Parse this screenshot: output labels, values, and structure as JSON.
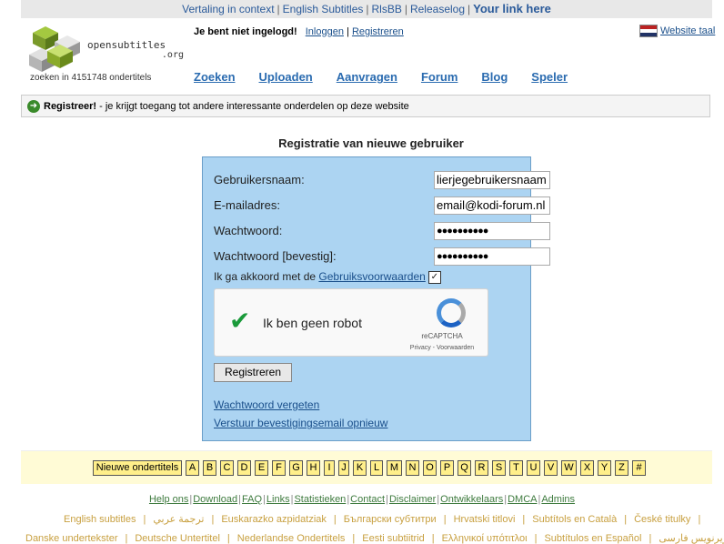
{
  "topbar": {
    "links": [
      "Vertaling in context",
      "English Subtitles",
      "RlsBB",
      "Releaselog"
    ],
    "highlight": "Your link here"
  },
  "header": {
    "logo_text": "opensubtitles",
    "logo_domain": ".org",
    "search_count": "zoeken in 4151748 ondertitels",
    "login_status": "Je bent niet ingelogd!",
    "login_link": "Inloggen",
    "register_link": "Registreren",
    "language": "Website taal"
  },
  "nav": [
    "Zoeken",
    "Uploaden",
    "Aanvragen",
    "Forum",
    "Blog",
    "Speler"
  ],
  "notice": {
    "bold": "Registreer!",
    "text": " - je krijgt toegang tot andere interessante onderdelen op deze website"
  },
  "form": {
    "title": "Registratie van nieuwe gebruiker",
    "username_label": "Gebruikersnaam:",
    "username_value": "lierjegebruikersnaam",
    "email_label": "E-mailadres:",
    "email_value": "email@kodi-forum.nl",
    "password_label": "Wachtwoord:",
    "password_value": "●●●●●●●●●●",
    "password_confirm_label": "Wachtwoord [bevestig]:",
    "password_confirm_value": "●●●●●●●●●●",
    "agree_text": "Ik ga akkoord met de ",
    "agree_link": "Gebruiksvoorwaarden",
    "agree_checked": "✓",
    "captcha_text": "Ik ben geen robot",
    "captcha_brand": "reCAPTCHA",
    "captcha_links": "Privacy - Voorwaarden",
    "submit_label": "Registreren",
    "forgot_password": "Wachtwoord vergeten",
    "resend_email": "Verstuur bevestigingsemail opnieuw"
  },
  "alphabet": {
    "new_label": "Nieuwe ondertitels",
    "letters": [
      "A",
      "B",
      "C",
      "D",
      "E",
      "F",
      "G",
      "H",
      "I",
      "J",
      "K",
      "L",
      "M",
      "N",
      "O",
      "P",
      "Q",
      "R",
      "S",
      "T",
      "U",
      "V",
      "W",
      "X",
      "Y",
      "Z",
      "#"
    ]
  },
  "footer": {
    "links": [
      "Help ons",
      "Download",
      "FAQ",
      "Links",
      "Statistieken",
      "Contact",
      "Disclaimer",
      "Ontwikkelaars",
      "DMCA",
      "Admins"
    ],
    "languages_row1": [
      "English subtitles",
      "ترجمة عربي",
      "Euskarazko azpidatziak",
      "Български субтитри",
      "Hrvatski titlovi",
      "Subtítols en Català",
      "České titulky"
    ],
    "languages_row2": [
      "Danske undertekster",
      "Deutsche Untertitel",
      "Nederlandse Ondertitels",
      "Eesti subtiitrid",
      "Ελληνικοί υπότιτλοι",
      "Subtítulos en Español",
      "زیرنویس فارسی"
    ]
  },
  "colors": {
    "form_bg": "#acd4f2",
    "alpha_bg": "#fffbd6",
    "link": "#1a4f8b"
  }
}
